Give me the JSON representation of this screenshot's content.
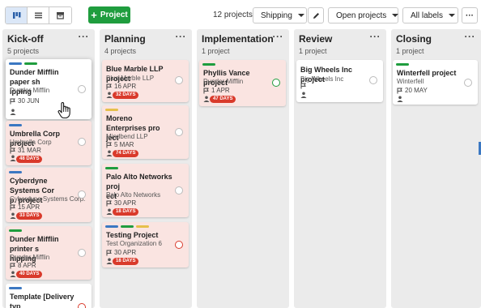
{
  "toolbar": {
    "add_label": "Project",
    "count": "12 projects",
    "shipping_label": "Shipping",
    "open_projects_label": "Open projects",
    "all_labels_label": "All labels"
  },
  "colors": {
    "accent": "#1f9d3e",
    "overdue": "#d93a2b",
    "tag_blue": "#3b78c2",
    "tag_green": "#1f9d3e",
    "tag_yellow": "#e6c04b"
  },
  "columns": [
    {
      "title": "Kick-off",
      "count": "5 projects",
      "cards": [
        {
          "title_lines": [
            "Dunder Mifflin paper sh",
            "ipping"
          ],
          "subtitle": "Dunder Mifflin",
          "date": "30 JUN",
          "badge": ""
        },
        {
          "title_lines": [
            "Umbrella Corp project"
          ],
          "subtitle": "Umbrella Corp",
          "date": "31 MAR",
          "badge": "48 DAYS"
        },
        {
          "title_lines": [
            "Cyberdyne Systems Cor",
            "p. project"
          ],
          "subtitle": "Cyberdyne Systems Corp.",
          "date": "15 APR",
          "badge": "33 DAYS"
        },
        {
          "title_lines": [
            "Dunder Mifflin printer s",
            "hipping"
          ],
          "subtitle": "Dunder Mifflin",
          "date": "8 APR",
          "badge": "40 DAYS"
        },
        {
          "title_lines": [
            "Template [Delivery typ"
          ],
          "subtitle": "",
          "date": "",
          "badge": ""
        }
      ]
    },
    {
      "title": "Planning",
      "count": "4 projects",
      "cards": [
        {
          "title_lines": [
            "Blue Marble LLP project"
          ],
          "subtitle": "Blue Marble LLP",
          "date": "16 APR",
          "badge": "32 DAYS"
        },
        {
          "title_lines": [
            "Moreno Enterprises pro",
            "ject"
          ],
          "subtitle": "Mindbend LLP",
          "date": "5 MAR",
          "badge": "74 DAYS"
        },
        {
          "title_lines": [
            "Palo Alto Networks proj",
            "ect"
          ],
          "subtitle": "Palo Alto Networks",
          "date": "30 APR",
          "badge": "18 DAYS"
        },
        {
          "title_lines": [
            "Testing Project"
          ],
          "subtitle": "Test Organization 6",
          "date": "30 APR",
          "badge": "18 DAYS"
        }
      ]
    },
    {
      "title": "Implementation",
      "count": "1 project",
      "cards": [
        {
          "title_lines": [
            "Phyllis Vance project"
          ],
          "subtitle": "Dunder Mifflin",
          "date": "1 APR",
          "badge": "47 DAYS"
        }
      ]
    },
    {
      "title": "Review",
      "count": "1 project",
      "cards": [
        {
          "title_lines": [
            "Big Wheels Inc project"
          ],
          "subtitle": "Big Wheels Inc",
          "date": "",
          "badge": ""
        }
      ]
    },
    {
      "title": "Closing",
      "count": "1 project",
      "cards": [
        {
          "title_lines": [
            "Winterfell project"
          ],
          "subtitle": "Winterfell",
          "date": "20 MAY",
          "badge": ""
        }
      ]
    }
  ]
}
